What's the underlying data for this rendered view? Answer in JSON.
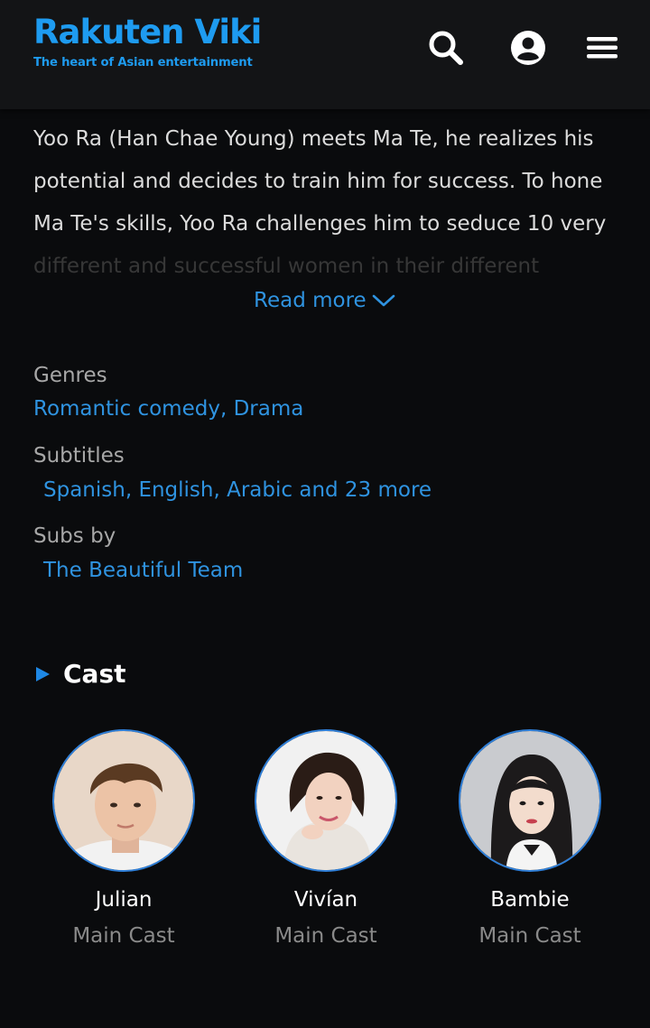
{
  "header": {
    "logo_text": "Rakuten Viki",
    "tagline": "The heart of Asian entertainment",
    "icons": [
      "search-icon",
      "user-icon",
      "menu-icon"
    ],
    "accent_color": "#1e9bf0"
  },
  "synopsis": {
    "lines": [
      "Yoo Ra (Han Chae Young) meets Ma Te, he realizes his",
      "potential and decides to train him for success. To hone",
      "Ma Te's skills, Yoo Ra challenges him to seduce 10 very"
    ],
    "faded_line": "different and successful women in their different",
    "read_more": "Read more"
  },
  "meta": {
    "genres_label": "Genres",
    "genres_value": "Romantic comedy, Drama",
    "subtitles_label": "Subtitles",
    "subtitles_value": "Spanish, English, Arabic and 23 more",
    "subs_by_label": "Subs by",
    "subs_by_value": "The Beautiful Team"
  },
  "cast": {
    "title": "Cast",
    "members": [
      {
        "name": "Julian",
        "role": "Main Cast"
      },
      {
        "name": "Vivían",
        "role": "Main Cast"
      },
      {
        "name": "Bambie",
        "role": "Main Cast"
      }
    ]
  }
}
